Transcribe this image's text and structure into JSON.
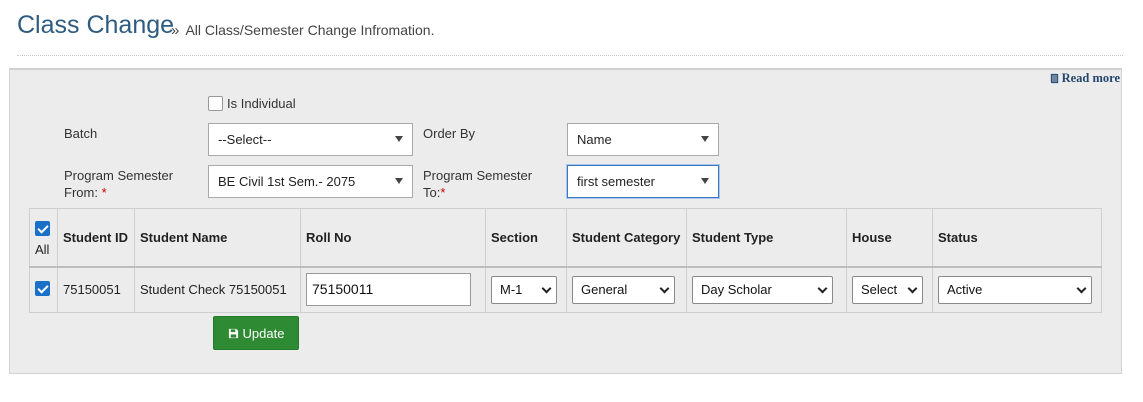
{
  "header": {
    "title": "Class Change",
    "subtitle_prefix": "»",
    "subtitle": "All Class/Semester Change Infromation."
  },
  "read_more": {
    "label": "Read more",
    "icon": "book-icon"
  },
  "filters": {
    "is_individual": {
      "label": "Is Individual",
      "checked": false
    },
    "batch": {
      "label": "Batch",
      "value": "--Select--"
    },
    "order_by": {
      "label": "Order By",
      "value": "Name"
    },
    "program_semester_from": {
      "label_line1": "Program Semester",
      "label_line2": "From:",
      "required": "*",
      "value": "BE Civil 1st Sem.- 2075"
    },
    "program_semester_to": {
      "label_line1": "Program Semester",
      "label_line2": "To:",
      "required": "*",
      "value": "first semester"
    }
  },
  "table": {
    "all_label": "All",
    "columns": [
      "Student ID",
      "Student Name",
      "Roll No",
      "Section",
      "Student Category",
      "Student Type",
      "House",
      "Status"
    ],
    "rows": [
      {
        "checked": true,
        "student_id": "75150051",
        "student_name": "Student Check 75150051",
        "roll_no": "75150011",
        "section": "M-1",
        "category": "General",
        "student_type": "Day Scholar",
        "house": "Select",
        "status": "Active"
      }
    ]
  },
  "update_button": {
    "label": "Update",
    "icon": "save-icon"
  },
  "colors": {
    "title": "#2e5c80",
    "button": "#2f8a34",
    "checkbox": "#1a6fc6",
    "panel": "#ececec"
  }
}
